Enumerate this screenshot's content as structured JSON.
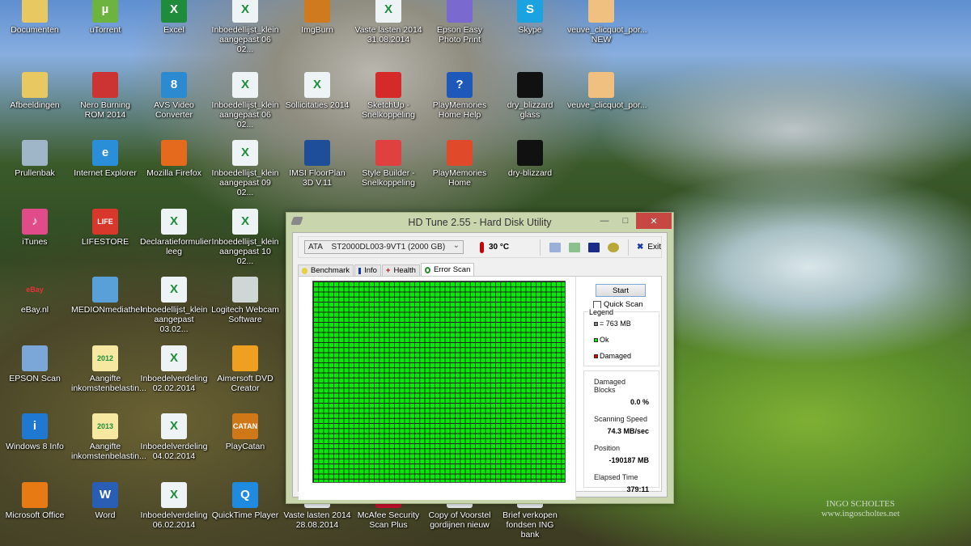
{
  "desktop": {
    "columns": [
      [
        {
          "label": "Documenten",
          "glyph": "folder",
          "color": "#e8c860",
          "text": ""
        },
        {
          "label": "Afbeeldingen",
          "glyph": "folder",
          "color": "#e8c860",
          "text": ""
        },
        {
          "label": "Prullenbak",
          "glyph": "recycle-bin",
          "color": "#9fb6c8",
          "text": ""
        },
        {
          "label": "iTunes",
          "glyph": "itunes",
          "color": "#e24b8a",
          "text": "♪"
        },
        {
          "label": "eBay.nl",
          "glyph": "ebay",
          "color": "transparent",
          "text": "eBay"
        },
        {
          "label": "EPSON Scan",
          "glyph": "scanner",
          "color": "#7aa6d8",
          "text": ""
        },
        {
          "label": "Windows 8 Info",
          "glyph": "info",
          "color": "#1f78d1",
          "text": "i"
        },
        {
          "label": "Microsoft Office",
          "glyph": "office",
          "color": "#e87a14",
          "text": ""
        }
      ],
      [
        {
          "label": "uTorrent",
          "glyph": "utorrent",
          "color": "#6cb33f",
          "text": "µ"
        },
        {
          "label": "Nero Burning ROM 2014",
          "glyph": "nero",
          "color": "#c33",
          "text": ""
        },
        {
          "label": "Internet Explorer",
          "glyph": "ie",
          "color": "#2a8fd8",
          "text": "e"
        },
        {
          "label": "LIFESTORE",
          "glyph": "lifestore",
          "color": "#d8372c",
          "text": "LIFE"
        },
        {
          "label": "MEDIONmediathek",
          "glyph": "monitor",
          "color": "#5aa0d8",
          "text": ""
        },
        {
          "label": "Aangifte inkomstenbelastin...",
          "glyph": "tax-2012",
          "color": "#f6e8a0",
          "text": "2012"
        },
        {
          "label": "Aangifte inkomstenbelastin...",
          "glyph": "tax-2013",
          "color": "#f6e8a0",
          "text": "2013"
        },
        {
          "label": "Word",
          "glyph": "word",
          "color": "#2a5eb4",
          "text": "W"
        }
      ],
      [
        {
          "label": "Excel",
          "glyph": "excel",
          "color": "#1e8c3a",
          "text": "X"
        },
        {
          "label": "AVS Video Converter",
          "glyph": "avs",
          "color": "#2c8ad0",
          "text": "8"
        },
        {
          "label": "Mozilla Firefox",
          "glyph": "firefox",
          "color": "#e66a1e",
          "text": ""
        },
        {
          "label": "Declaratieformulier leeg",
          "glyph": "excel-file",
          "color": "#eef3f6",
          "text": "X"
        },
        {
          "label": "Inboedellijst_klein aangepast 03.02...",
          "glyph": "excel-file",
          "color": "#eef3f6",
          "text": "X"
        },
        {
          "label": "Inboedelverdeling 02.02.2014",
          "glyph": "excel-file",
          "color": "#eef3f6",
          "text": "X"
        },
        {
          "label": "Inboedelverdeling 04.02.2014",
          "glyph": "excel-file",
          "color": "#eef3f6",
          "text": "X"
        },
        {
          "label": "Inboedelverdeling 06.02.2014",
          "glyph": "excel-file",
          "color": "#eef3f6",
          "text": "X"
        }
      ],
      [
        {
          "label": "Inboedellijst_klein aangepast 06 02...",
          "glyph": "excel-file",
          "color": "#eef3f6",
          "text": "X"
        },
        {
          "label": "Inboedellijst_klein aangepast 06 02...",
          "glyph": "excel-file",
          "color": "#eef3f6",
          "text": "X"
        },
        {
          "label": "Inboedellijst_klein aangepast 09 02...",
          "glyph": "excel-file",
          "color": "#eef3f6",
          "text": "X"
        },
        {
          "label": "Inboedellijst_klein aangepast 10 02...",
          "glyph": "excel-file",
          "color": "#eef3f6",
          "text": "X"
        },
        {
          "label": "Logitech Webcam Software",
          "glyph": "webcam",
          "color": "#cfd6d6",
          "text": ""
        },
        {
          "label": "Aimersoft DVD Creator",
          "glyph": "dvd",
          "color": "#f0a020",
          "text": ""
        },
        {
          "label": "PlayCatan",
          "glyph": "catan",
          "color": "#d07818",
          "text": "CATAN"
        },
        {
          "label": "QuickTime Player",
          "glyph": "quicktime",
          "color": "#1e8ae0",
          "text": "Q"
        }
      ],
      [
        {
          "label": "ImgBurn",
          "glyph": "imgburn",
          "color": "#d07a20",
          "text": ""
        },
        {
          "label": "Sollicitaties 2014",
          "glyph": "excel-file",
          "color": "#eef3f6",
          "text": "X"
        },
        {
          "label": "IMSI FloorPlan 3D V.11",
          "glyph": "floorplan",
          "color": "#1e4e98",
          "text": ""
        },
        null,
        null,
        null,
        null,
        {
          "label": "Vaste lasten 2014 28.08.2014",
          "glyph": "excel-file",
          "color": "#eef3f6",
          "text": "X"
        }
      ],
      [
        {
          "label": "Vaste lasten 2014 31.08.2014",
          "glyph": "excel-file",
          "color": "#eef3f6",
          "text": "X"
        },
        {
          "label": "SketchUp - Snelkoppeling",
          "glyph": "sketchup",
          "color": "#d42a2a",
          "text": ""
        },
        {
          "label": "Style Builder - Snelkoppeling",
          "glyph": "stylebuilder",
          "color": "#e04040",
          "text": ""
        },
        null,
        null,
        null,
        null,
        {
          "label": "McAfee Security Scan Plus",
          "glyph": "mcafee",
          "color": "#c8102e",
          "text": ""
        }
      ],
      [
        {
          "label": "Epson Easy Photo Print",
          "glyph": "epson-photo",
          "color": "#7a6ad0",
          "text": ""
        },
        {
          "label": "PlayMemories Home Help",
          "glyph": "help",
          "color": "#1e58b8",
          "text": "?"
        },
        {
          "label": "PlayMemories Home",
          "glyph": "playmemories",
          "color": "#e04a2a",
          "text": ""
        },
        null,
        null,
        null,
        null,
        {
          "label": "Copy of Voorstel gordijnen nieuw",
          "glyph": "document",
          "color": "#eef3f6",
          "text": ""
        }
      ],
      [
        {
          "label": "Skype",
          "glyph": "skype",
          "color": "#1aa3e0",
          "text": "S"
        },
        {
          "label": "dry_blizzard glass",
          "glyph": "image",
          "color": "#111",
          "text": ""
        },
        {
          "label": "dry-blizzard",
          "glyph": "image",
          "color": "#111",
          "text": ""
        },
        null,
        null,
        null,
        null,
        {
          "label": "Brief verkopen fondsen ING bank",
          "glyph": "document",
          "color": "#eef3f6",
          "text": ""
        }
      ],
      [
        {
          "label": "veuve_clicquot_por... NEW",
          "glyph": "image",
          "color": "#f0c080",
          "text": ""
        },
        {
          "label": "veuve_clicquot_por...",
          "glyph": "image",
          "color": "#f0c080",
          "text": ""
        }
      ]
    ]
  },
  "watermark": {
    "line1": "INGO SCHOLTES",
    "line2": "www.ingoscholtes.net"
  },
  "window": {
    "title": "HD Tune 2.55 - Hard Disk Utility",
    "drive": "ATA    ST2000DL003-9VT1 (2000 GB)",
    "temperature": "30 °C",
    "exit_label": "Exit",
    "tabs": [
      "Benchmark",
      "Info",
      "Health",
      "Error Scan"
    ],
    "active_tab": "Error Scan",
    "start_label": "Start",
    "quick_scan_label": "Quick Scan",
    "quick_scan_checked": false,
    "legend": {
      "title": "Legend",
      "block": "= 763 MB",
      "ok": "Ok",
      "damaged": "Damaged"
    },
    "stats": {
      "damaged_blocks_label": "Damaged Blocks",
      "damaged_blocks": "0.0 %",
      "speed_label": "Scanning Speed",
      "speed": "74.3 MB/sec",
      "position_label": "Position",
      "position": "-190187 MB",
      "elapsed_label": "Elapsed Time",
      "elapsed": "379:11"
    },
    "scan_progress": 1.0,
    "colors": {
      "ok": "#00ee00",
      "damaged": "#dd0000",
      "block": "#808080"
    }
  }
}
